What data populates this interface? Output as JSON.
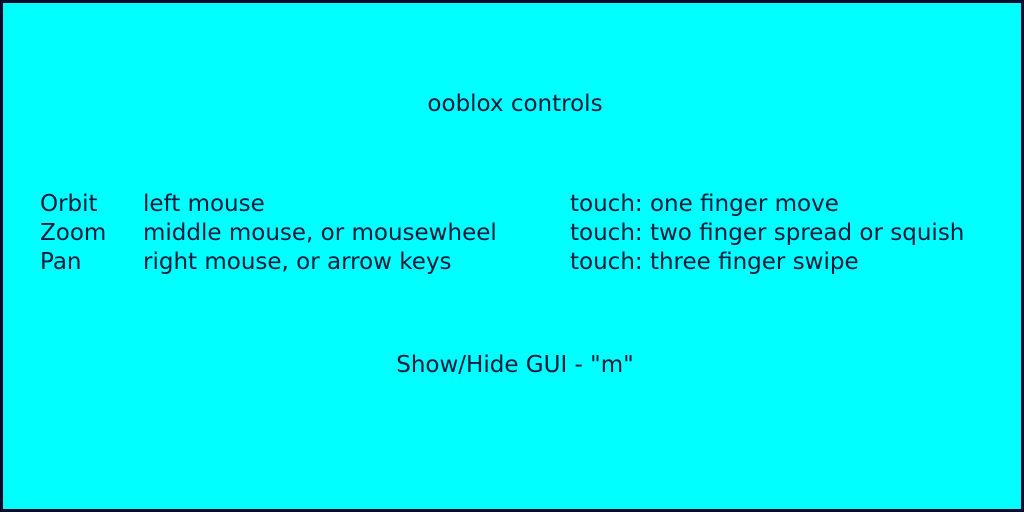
{
  "title": "ooblox controls",
  "controls": [
    {
      "action": "Orbit",
      "mouse": "left mouse",
      "touch": "touch: one finger move"
    },
    {
      "action": "Zoom",
      "mouse": "middle mouse, or mousewheel",
      "touch": "touch: two finger spread or squish"
    },
    {
      "action": "Pan",
      "mouse": "right mouse, or arrow keys",
      "touch": "touch: three finger swipe"
    }
  ],
  "footer": "Show/Hide GUI - \"m\"",
  "colors": {
    "background": "#00ffff",
    "text": "#0a1a3a",
    "border": "#0a0a2a"
  }
}
